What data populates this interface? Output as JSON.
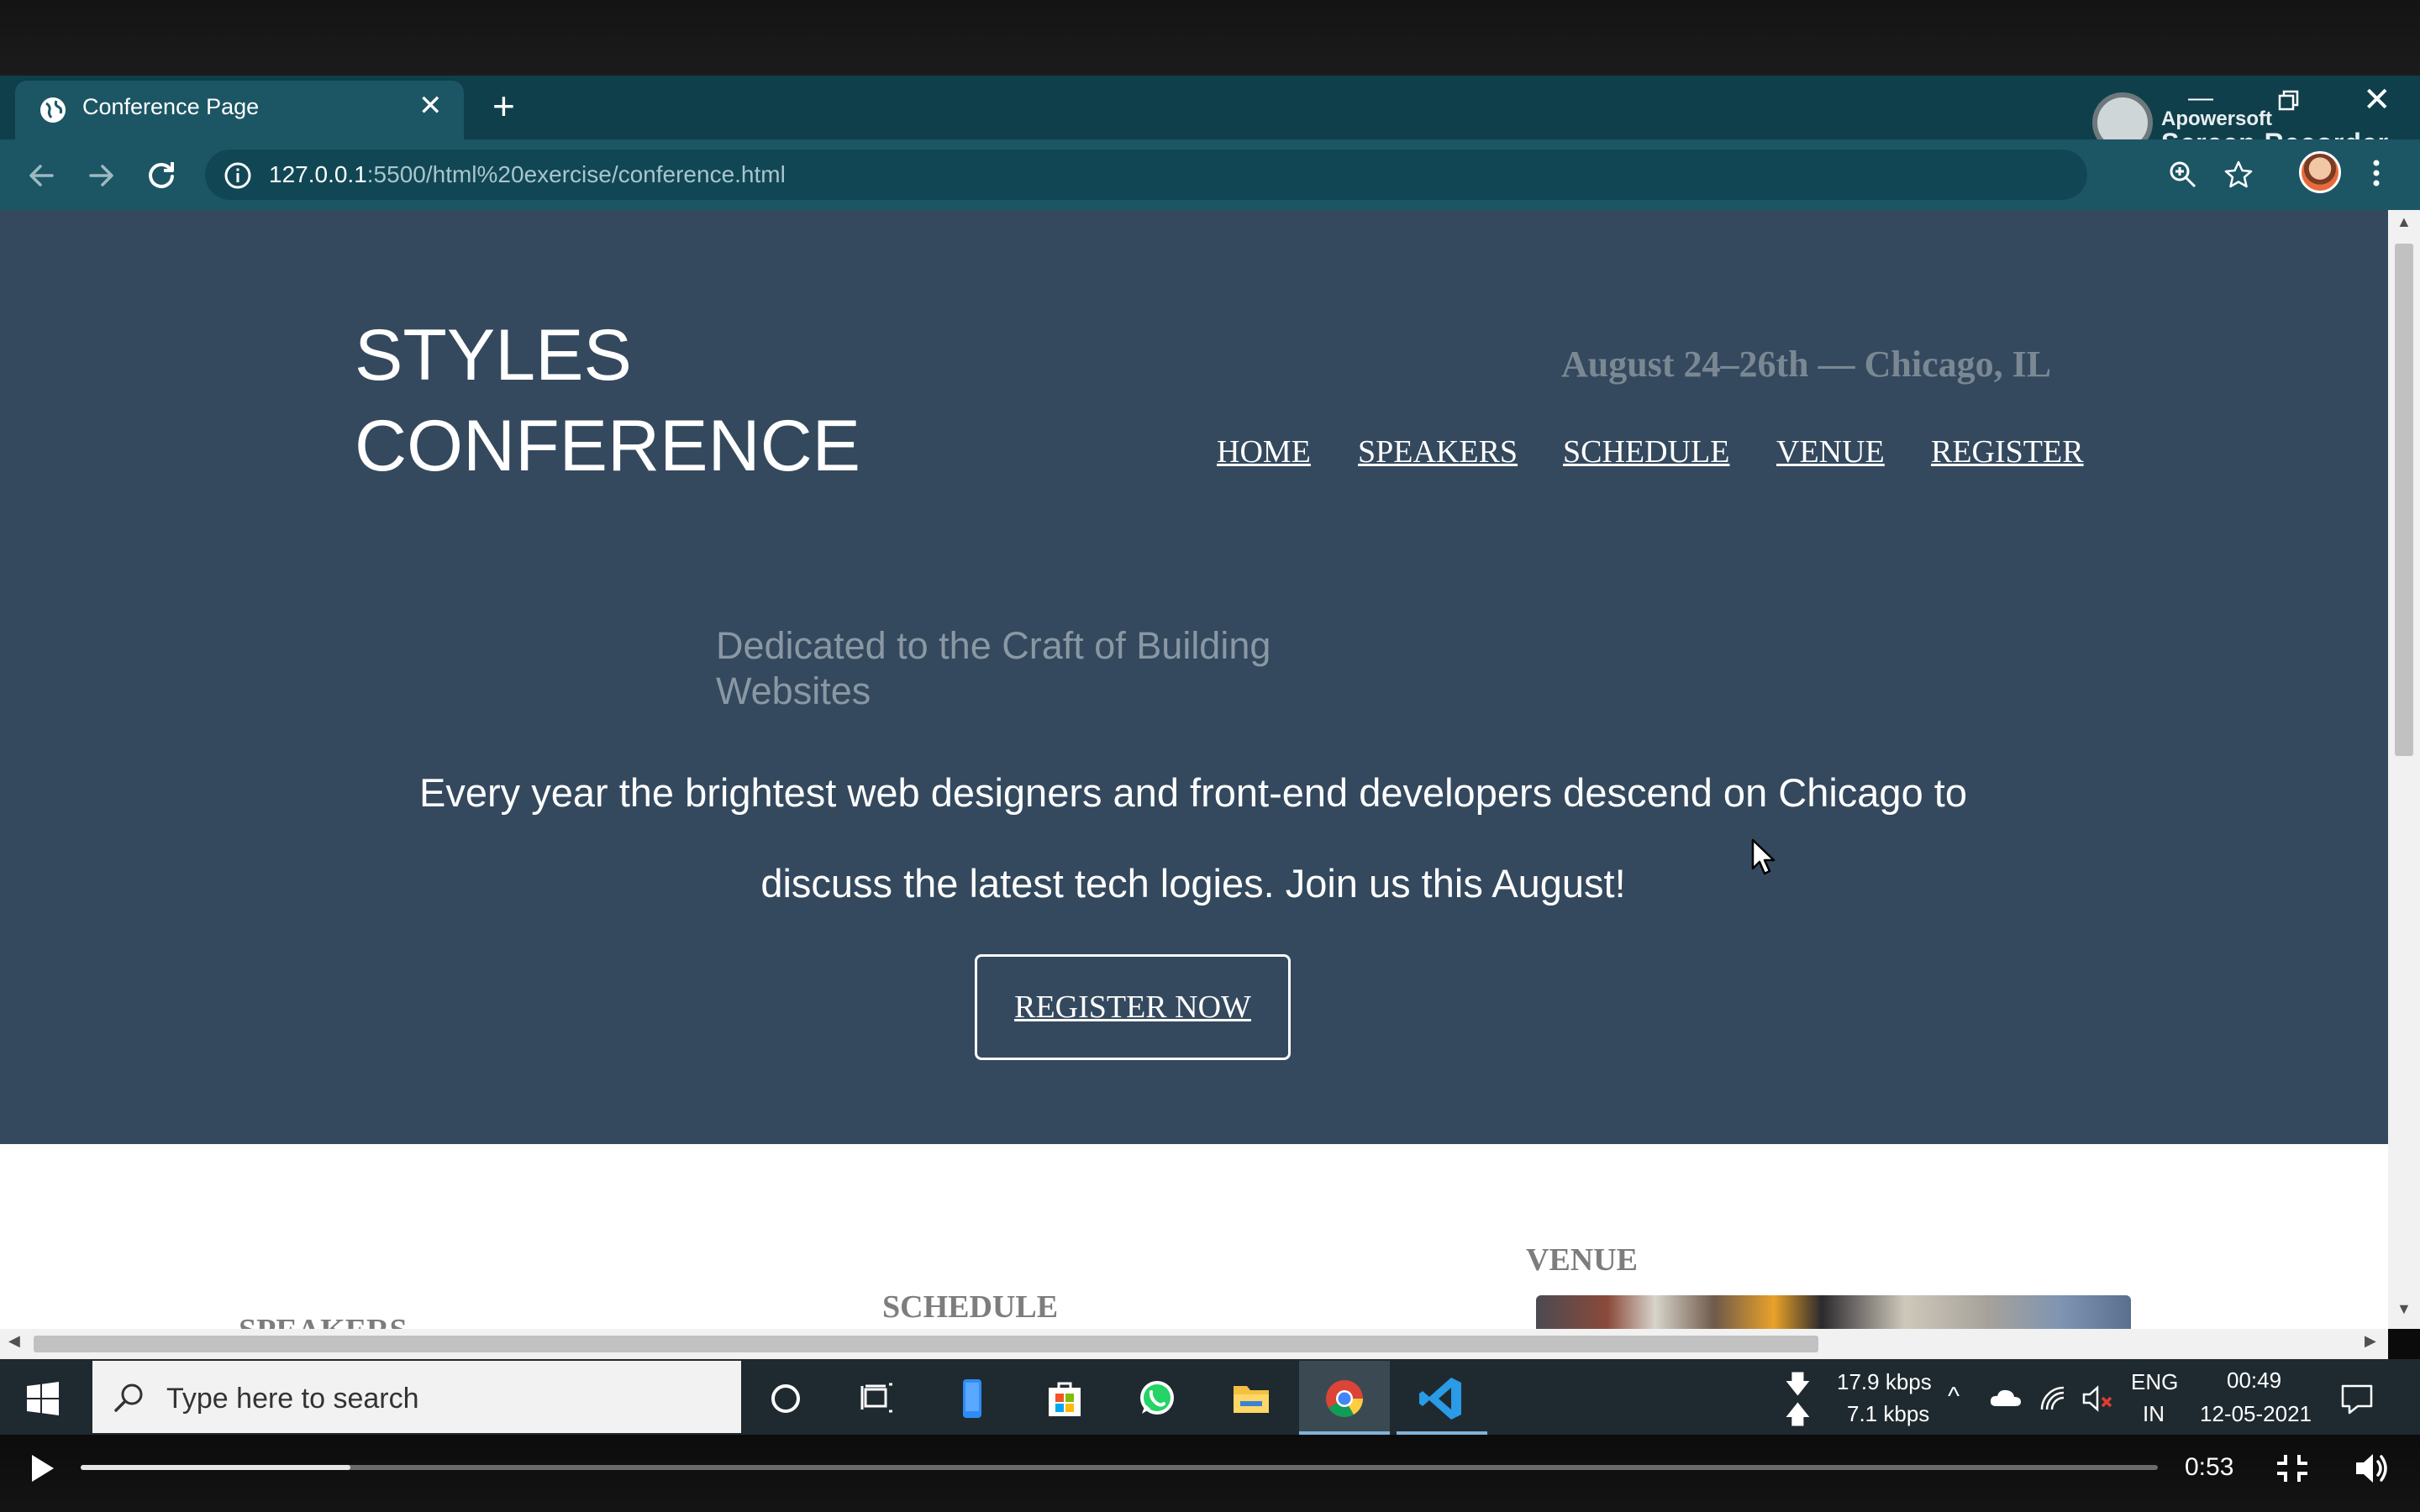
{
  "browser": {
    "tab_title": "Conference Page",
    "new_tab_label": "+",
    "close_label": "✕",
    "url_host": "127.0.0.1",
    "url_path": ":5500/html%20exercise/conference.html"
  },
  "window_controls": {
    "minimize": "—",
    "close": "✕"
  },
  "recorder": {
    "brand": "Apowersoft",
    "name": "Screen Recorder"
  },
  "page": {
    "logo_line1": "STYLES",
    "logo_line2": "CONFERENCE",
    "event_tagline": "August 24–26th — Chicago, IL",
    "nav": [
      "HOME",
      "SPEAKERS",
      "SCHEDULE",
      "VENUE",
      "REGISTER"
    ],
    "subtitle": "Dedicated to the Craft of Building Websites",
    "intro": "Every year the brightest web designers and front-end developers descend on Chicago to discuss the latest tech logies. Join us this August!",
    "cta": "REGISTER NOW",
    "sections": {
      "speakers": "SPEAKERS",
      "schedule": "SCHEDULE",
      "venue": "VENUE"
    }
  },
  "taskbar": {
    "search_placeholder": "Type here to search",
    "net_down": "17.9 kbps",
    "net_up": "7.1 kbps",
    "lang_line1": "ENG",
    "lang_line2": "IN",
    "time": "00:49",
    "date": "12-05-2021"
  },
  "player": {
    "elapsed": "0:53",
    "progress_fraction": 0.13
  },
  "colors": {
    "hero_bg": "#34495e",
    "chrome_tabbar": "#0f3f4b",
    "chrome_toolbar": "#1c5665",
    "taskbar": "#1f2a30"
  }
}
